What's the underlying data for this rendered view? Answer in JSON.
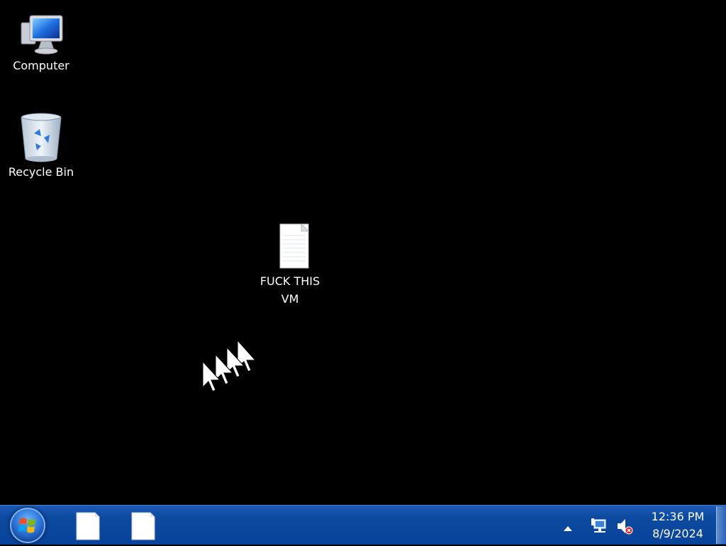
{
  "desktop": {
    "icons": [
      {
        "label": "Computer"
      },
      {
        "label": "Recycle Bin"
      },
      {
        "label": "FUCK THIS VM"
      }
    ]
  },
  "taskbar": {
    "start_button": "start-orb",
    "pinned": [
      "notepad-file-icon",
      "notepad-file-icon"
    ],
    "tray": {
      "icons": [
        "show-hidden-icons-arrow",
        "network-icon",
        "volume-muted-icon"
      ],
      "time": "12:36 PM",
      "date": "8/9/2024"
    }
  },
  "colors": {
    "desktop_bg": "#000000",
    "taskbar_bg": "#0c4a9f"
  }
}
